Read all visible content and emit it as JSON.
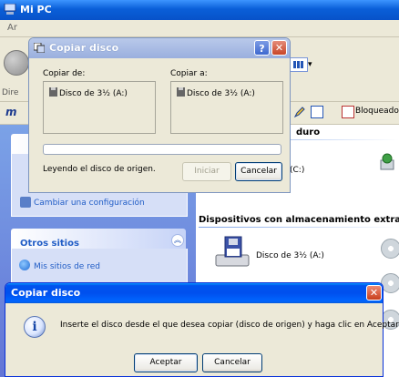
{
  "explorer": {
    "title": "Mi PC",
    "menubar_fragment": "Ar",
    "address_fragment": "Dire",
    "toolbar_fragment": "m",
    "locked_label": "Bloqueado",
    "task_pane": {
      "change_config": "Cambiar una configuración",
      "other_sites_heading": "Otros sitios",
      "my_network": "Mis sitios de red"
    },
    "content": {
      "hdd_heading": "duro",
      "drive_c": "(C:)",
      "removable_heading": "Dispositivos con almacenamiento extraíbl",
      "floppy_drive": "Disco de 3½ (A:)"
    }
  },
  "copy_dialog": {
    "title": "Copiar disco",
    "help_button": "?",
    "close_button": "✕",
    "copy_from_label": "Copiar de:",
    "copy_to_label": "Copiar a:",
    "source_drive": "Disco de 3½ (A:)",
    "target_drive": "Disco de 3½ (A:)",
    "progress": 0,
    "status": "Leyendo el disco de origen.",
    "start_button": "Iniciar",
    "cancel_button": "Cancelar"
  },
  "message_box": {
    "title": "Copiar disco",
    "close_button": "✕",
    "icon": "info-icon",
    "message": "Inserte el disco desde el que desea copiar (disco de origen) y haga clic en Aceptar.",
    "ok_button": "Aceptar",
    "cancel_button": "Cancelar"
  }
}
